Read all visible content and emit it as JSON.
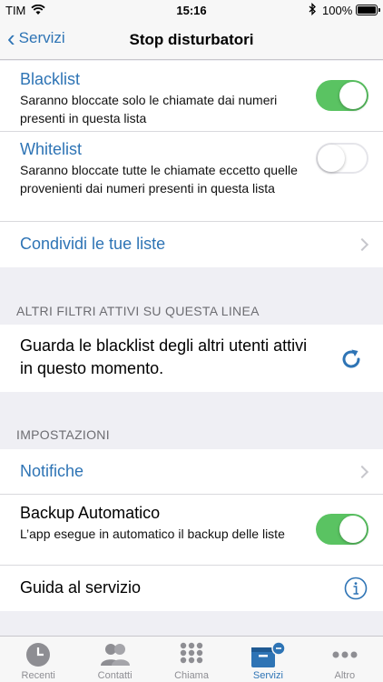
{
  "status": {
    "carrier": "TIM",
    "time": "15:16",
    "battery": "100%"
  },
  "nav": {
    "back_label": "Servizi",
    "title": "Stop disturbatori"
  },
  "lists": {
    "blacklist": {
      "title": "Blacklist",
      "desc": "Saranno bloccate solo le chiamate dai numeri presenti in questa lista",
      "enabled": true
    },
    "whitelist": {
      "title": "Whitelist",
      "desc": "Saranno bloccate tutte le chiamate eccetto quelle provenienti dai numeri presenti in questa lista",
      "enabled": false
    },
    "share": {
      "label": "Condividi le tue liste"
    }
  },
  "filters": {
    "header": "ALTRI FILTRI ATTIVI SU QUESTA LINEA",
    "row_text": "Guarda le blacklist degli altri utenti attivi in questo momento."
  },
  "settings": {
    "header": "IMPOSTAZIONI",
    "notifications": "Notifiche",
    "backup_title": "Backup Automatico",
    "backup_desc": "L’app esegue in automatico il backup delle liste",
    "backup_enabled": true,
    "guide": "Guida al servizio"
  },
  "tabs": [
    {
      "label": "Recenti",
      "icon": "clock-icon"
    },
    {
      "label": "Contatti",
      "icon": "contacts-icon"
    },
    {
      "label": "Chiama",
      "icon": "keypad-icon"
    },
    {
      "label": "Servizi",
      "icon": "services-icon",
      "active": true
    },
    {
      "label": "Altro",
      "icon": "more-icon"
    }
  ],
  "colors": {
    "accent": "#2e74b5",
    "toggle_on": "#5ac362",
    "background": "#efeff4"
  }
}
